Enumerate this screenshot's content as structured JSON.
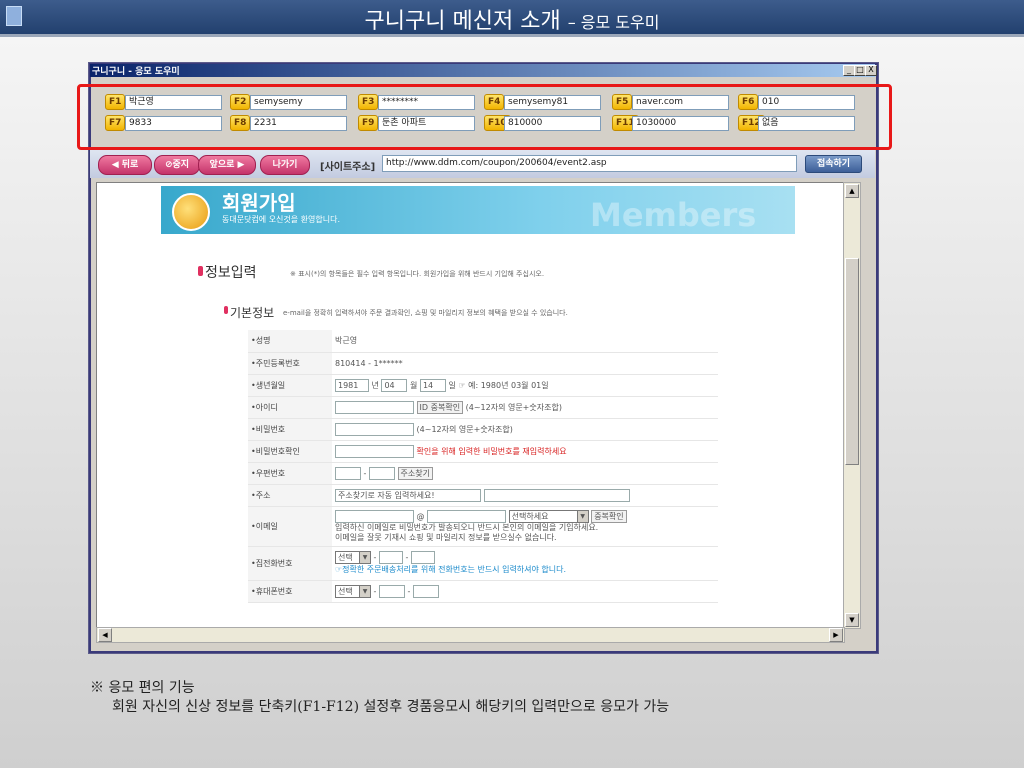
{
  "slide": {
    "title": "구니구니 메신저 소개",
    "subtitle": "– 응모 도우미"
  },
  "window": {
    "title": "구니구니 - 응모 도우미",
    "min_label": "_",
    "max_label": "□",
    "close_label": "X"
  },
  "hotkeys": [
    {
      "key": "F1",
      "value": "박근영"
    },
    {
      "key": "F2",
      "value": "semysemy"
    },
    {
      "key": "F3",
      "value": "********"
    },
    {
      "key": "F4",
      "value": "semysemy81"
    },
    {
      "key": "F5",
      "value": "naver.com"
    },
    {
      "key": "F6",
      "value": "010"
    },
    {
      "key": "F7",
      "value": "9833"
    },
    {
      "key": "F8",
      "value": "2231"
    },
    {
      "key": "F9",
      "value": "둔촌 아파트"
    },
    {
      "key": "F10",
      "value": "810000"
    },
    {
      "key": "F11",
      "value": "1030000"
    },
    {
      "key": "F12",
      "value": "없음"
    }
  ],
  "nav": {
    "back": "뒤로",
    "stop": "중지",
    "forward": "앞으로",
    "exit": "나가기",
    "address_label": "[사이트주소]",
    "address": "http://www.ddm.com/coupon/200604/event2.asp",
    "go": "접속하기"
  },
  "page": {
    "banner_title": "회원가입",
    "banner_sub": "동대문닷컴에 오신것을 환영합니다.",
    "banner_bg_text": "Members",
    "info_title": "정보입력",
    "info_note": "※ 표시(*)의 항목들은 필수 입력 항목입니다. 회원가입을 위해 반드시 기입해 주십시오.",
    "basic_title": "기본정보",
    "basic_note": "e-mail을 정확히 입력하셔야 주문 결과확인, 쇼핑 및 마일리지 정보의 혜택을 받으실 수 있습니다.",
    "fields": {
      "name_label": "•성명",
      "name_value": "박근영",
      "ssn_label": "•주민등록번호",
      "ssn_value": "810414 - 1******",
      "birth_label": "•생년월일",
      "birth_year": "1981",
      "birth_year_unit": "년",
      "birth_month": "04",
      "birth_month_unit": "월",
      "birth_day": "14",
      "birth_day_unit": "일",
      "birth_example": "☞ 예: 1980년 03월 01일",
      "id_label": "•아이디",
      "id_check": "ID 중복확인",
      "id_hint": "(4~12자의 영문+숫자조합)",
      "pw_label": "•비밀번호",
      "pw_hint": "(4~12자의 영문+숫자조합)",
      "pw2_label": "•비밀번호확인",
      "pw2_hint": "확인을 위해 입력한 비밀번호를 재입력하세요",
      "zip_label": "•우편번호",
      "zip_dash": "-",
      "zip_search": "주소찾기",
      "addr_label": "•주소",
      "addr_placeholder": "주소찾기로 자동 입력하세요!",
      "email_label": "•이메일",
      "email_at": "@",
      "email_select": "선택하세요",
      "email_check": "중복확인",
      "email_hint1": "입력하신 이메일로 비밀번호가 발송되오니 반드시 본인의 이메일을 기입하세요.",
      "email_hint2": "이메일을 잘못 기재시 쇼핑 및 마일리지 정보를 받으실수 없습니다.",
      "home_label": "•집전화번호",
      "home_select": "선택",
      "home_dash": "-",
      "home_hint": "☞정확한 주문배송처리를 위해 전화번호는 반드시 입력하셔야 합니다.",
      "mobile_label": "•휴대폰번호",
      "mobile_select": "선택",
      "mobile_dash": "-"
    }
  },
  "footer": {
    "line1": "※ 응모 편의 기능",
    "line2": "회원 자신의 신상 정보를 단축키(F1-F12) 설정후 경품응모시 해당키의 입력만으로 응모가 가능"
  }
}
